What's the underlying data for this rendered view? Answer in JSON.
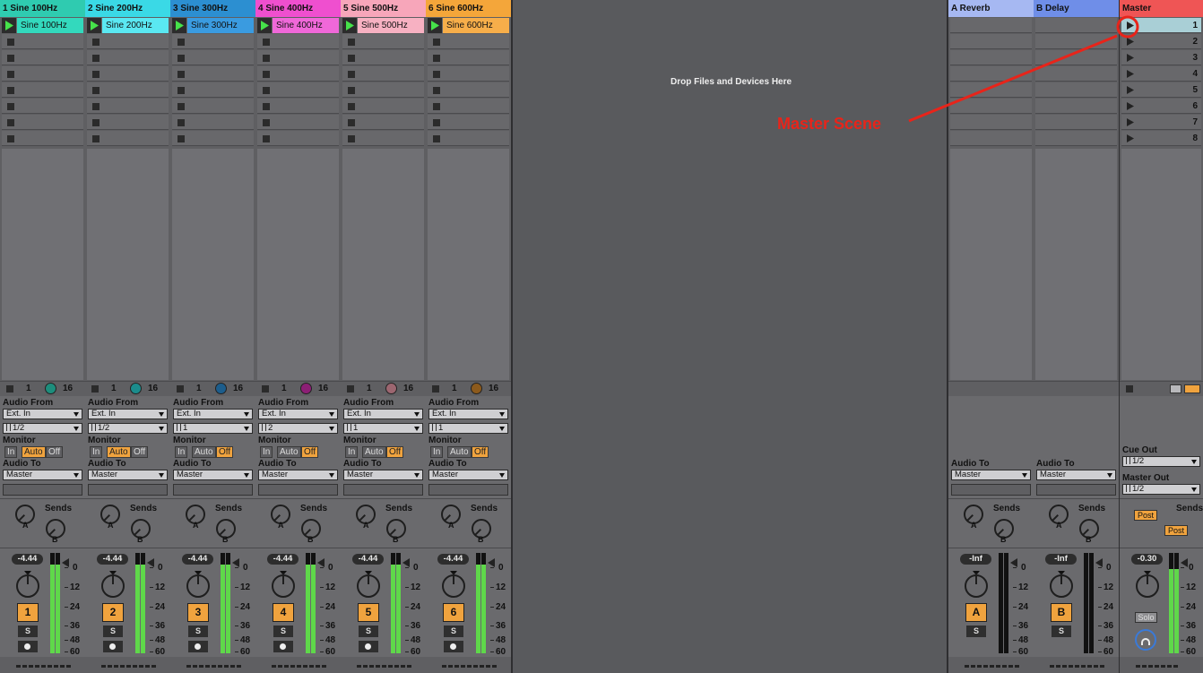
{
  "tracks": [
    {
      "name": "1 Sine 100Hz",
      "clip": "Sine 100Hz",
      "color": "#2fcbb0",
      "clip_color": "#33d9bd",
      "dot_color": "#1d8d7c",
      "input_type": "Ext. In",
      "input_channel": "1/2",
      "monitor_state": "Auto",
      "audio_to": "Master",
      "volume": "-4.44",
      "number": "1",
      "meter": 0.88
    },
    {
      "name": "2 Sine 200Hz",
      "clip": "Sine 200Hz",
      "color": "#3ad9e6",
      "clip_color": "#5ae8f2",
      "dot_color": "#1b8c8c",
      "input_type": "Ext. In",
      "input_channel": "1/2",
      "monitor_state": "Auto",
      "audio_to": "Master",
      "volume": "-4.44",
      "number": "2",
      "meter": 0.88
    },
    {
      "name": "3 Sine 300Hz",
      "clip": "Sine 300Hz",
      "color": "#2c8fd1",
      "clip_color": "#3a9be0",
      "dot_color": "#1c5d8c",
      "input_type": "Ext. In",
      "input_channel": "1",
      "monitor_state": "Off",
      "audio_to": "Master",
      "volume": "-4.44",
      "number": "3",
      "meter": 0.88
    },
    {
      "name": "4 Sine 400Hz",
      "clip": "Sine 400Hz",
      "color": "#ef4fcf",
      "clip_color": "#f068d9",
      "dot_color": "#8c1f75",
      "input_type": "Ext. In",
      "input_channel": "2",
      "monitor_state": "Off",
      "audio_to": "Master",
      "volume": "-4.44",
      "number": "4",
      "meter": 0.88
    },
    {
      "name": "5 Sine 500Hz",
      "clip": "Sine 500Hz",
      "color": "#f7a6ba",
      "clip_color": "#f7b1c2",
      "dot_color": "#9c6670",
      "input_type": "Ext. In",
      "input_channel": "1",
      "monitor_state": "Off",
      "audio_to": "Master",
      "volume": "-4.44",
      "number": "5",
      "meter": 0.88
    },
    {
      "name": "6 Sine 600Hz",
      "clip": "Sine 600Hz",
      "color": "#f4a63a",
      "clip_color": "#f7ae4a",
      "dot_color": "#8c5a1c",
      "input_type": "Ext. In",
      "input_channel": "1",
      "monitor_state": "Off",
      "audio_to": "Master",
      "volume": "-4.44",
      "number": "6",
      "meter": 0.88
    }
  ],
  "labels": {
    "audio_from": "Audio From",
    "monitor": "Monitor",
    "audio_to": "Audio To",
    "sends": "Sends",
    "send_a": "A",
    "send_b": "B",
    "mon_in": "In",
    "mon_auto": "Auto",
    "mon_off": "Off",
    "solo_s": "S",
    "ctrl_one": "1",
    "ctrl_sixteen": "16",
    "drop_hint": "Drop Files and Devices Here",
    "cue_out": "Cue Out",
    "master_out": "Master Out",
    "post": "Post",
    "solo": "Solo"
  },
  "db_scale": [
    "0",
    "12",
    "24",
    "36",
    "48",
    "60"
  ],
  "returns": [
    {
      "name": "A Reverb",
      "color": "#a6b8f2",
      "audio_to": "Master",
      "volume": "-Inf",
      "letter": "A"
    },
    {
      "name": "B Delay",
      "color": "#6f8ee8",
      "audio_to": "Master",
      "volume": "-Inf",
      "letter": "B"
    }
  ],
  "master": {
    "name": "Master",
    "color": "#ef5555",
    "scenes": [
      "1",
      "2",
      "3",
      "4",
      "5",
      "6",
      "7",
      "8"
    ],
    "cue_out": "1/2",
    "master_out": "1/2",
    "volume": "-0.30",
    "meter": 0.84
  },
  "annotation": {
    "text": "Master Scene",
    "color": "#e8241a"
  }
}
